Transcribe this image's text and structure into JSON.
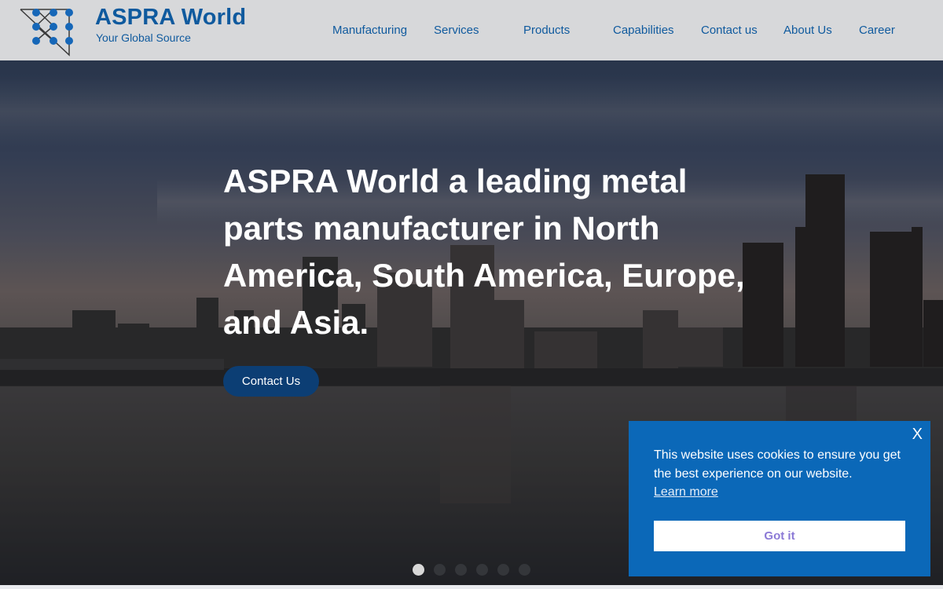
{
  "header": {
    "brand_title": "ASPRA World",
    "brand_subtitle": "Your Global Source",
    "logo_icon": "network-triangle-logo"
  },
  "nav": {
    "items": [
      {
        "label": "Manufacturing"
      },
      {
        "label": "Services"
      },
      {
        "label": "Products"
      },
      {
        "label": "Capabilities"
      },
      {
        "label": "Contact us"
      },
      {
        "label": "About Us"
      },
      {
        "label": "Career"
      }
    ]
  },
  "hero": {
    "headline": "ASPRA World a leading metal parts manufacturer in North America, South America, Europe, and Asia.",
    "button_label": "Contact Us",
    "slides_total": 6,
    "active_slide": 1
  },
  "cookie": {
    "close_label": "X",
    "message": "This website uses cookies to ensure you get the best experience on our website.",
    "learn_more": "Learn more",
    "accept_label": "Got it"
  },
  "colors": {
    "brand_blue": "#0f5a9e",
    "header_bg": "#d7d8da",
    "button_dark_blue": "#0c3e74",
    "cookie_bg": "#0b68b8",
    "cookie_button_text": "#8b79d6"
  }
}
